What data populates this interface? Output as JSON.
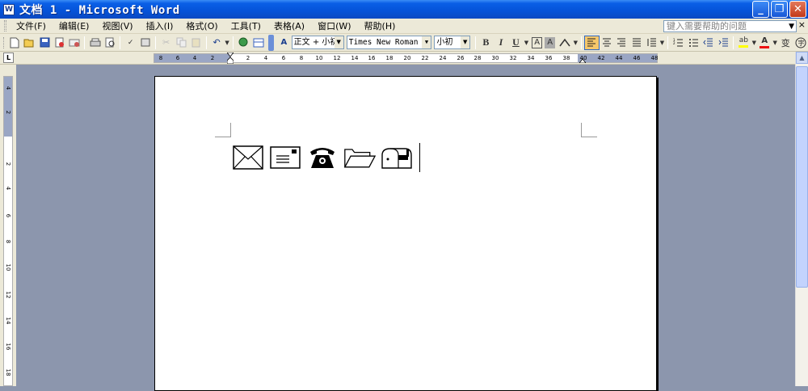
{
  "window": {
    "title": "文档 1 - Microsoft Word",
    "icon": "word-doc-icon",
    "buttons": [
      "_",
      "❐",
      "✕"
    ]
  },
  "menu": {
    "items": [
      "文件(F)",
      "编辑(E)",
      "视图(V)",
      "插入(I)",
      "格式(O)",
      "工具(T)",
      "表格(A)",
      "窗口(W)",
      "帮助(H)"
    ],
    "help_placeholder": "键入需要帮助的问题"
  },
  "toolbar": {
    "style_value": "正文 + 小初",
    "font_value": "Times New Roman",
    "size_value": "小初",
    "bold": "B",
    "italic": "I",
    "underline": "U",
    "char_border": "A",
    "char_shading": "A",
    "phonetic": "变"
  },
  "ruler": {
    "tab_selector": "L",
    "h_numbers": [
      "8",
      "6",
      "4",
      "2",
      "2",
      "4",
      "6",
      "8",
      "10",
      "12",
      "14",
      "16",
      "18",
      "20",
      "22",
      "24",
      "26",
      "28",
      "30",
      "32",
      "34",
      "36",
      "38",
      "40",
      "42",
      "44",
      "46",
      "48"
    ],
    "v_numbers": [
      "4",
      "2",
      "2",
      "4",
      "6",
      "8",
      "10",
      "12",
      "14",
      "16",
      "18"
    ]
  },
  "document": {
    "symbols": [
      "envelope-icon",
      "postcard-icon",
      "telephone-icon",
      "open-folder-icon",
      "mailbox-icon"
    ]
  },
  "colors": {
    "titlebar": "#0553d8",
    "chrome": "#ece9d8",
    "workspace": "#8c96ad",
    "active_align": "#f5c76a"
  }
}
